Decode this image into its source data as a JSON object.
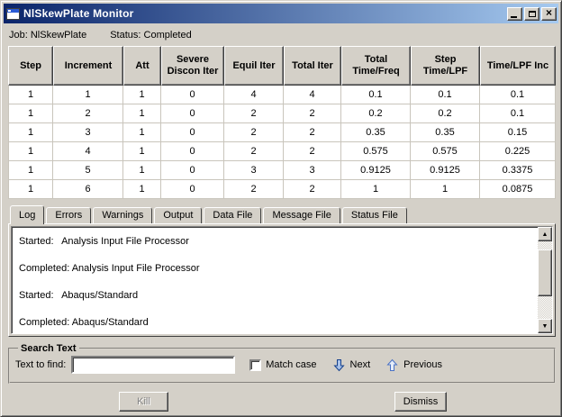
{
  "window": {
    "title": "NlSkewPlate Monitor"
  },
  "icons": {
    "close": "×",
    "scroll_up": "▲",
    "scroll_down": "▼"
  },
  "colors": {
    "chrome": "#d4d0c8",
    "titlebar_start": "#0a246a",
    "titlebar_end": "#a6caf0",
    "next_arrow_fill": "#a9c2e9",
    "next_arrow_stroke": "#16418c",
    "prev_arrow_fill": "#e6edf9",
    "prev_arrow_stroke": "#4a72c4"
  },
  "status_line": {
    "job_label": "Job:",
    "job_value": "NlSkewPlate",
    "status_label": "Status:",
    "status_value": "Completed"
  },
  "table": {
    "headers": [
      "Step",
      "Increment",
      "Att",
      "Severe Discon Iter",
      "Equil Iter",
      "Total Iter",
      "Total Time/Freq",
      "Step Time/LPF",
      "Time/LPF Inc"
    ],
    "rows": [
      [
        "1",
        "1",
        "1",
        "0",
        "4",
        "4",
        "0.1",
        "0.1",
        "0.1"
      ],
      [
        "1",
        "2",
        "1",
        "0",
        "2",
        "2",
        "0.2",
        "0.2",
        "0.1"
      ],
      [
        "1",
        "3",
        "1",
        "0",
        "2",
        "2",
        "0.35",
        "0.35",
        "0.15"
      ],
      [
        "1",
        "4",
        "1",
        "0",
        "2",
        "2",
        "0.575",
        "0.575",
        "0.225"
      ],
      [
        "1",
        "5",
        "1",
        "0",
        "3",
        "3",
        "0.9125",
        "0.9125",
        "0.3375"
      ],
      [
        "1",
        "6",
        "1",
        "0",
        "2",
        "2",
        "1",
        "1",
        "0.0875"
      ]
    ]
  },
  "tabs": {
    "items": [
      "Log",
      "Errors",
      "Warnings",
      "Output",
      "Data File",
      "Message File",
      "Status File"
    ],
    "active_index": 0
  },
  "log": {
    "lines": [
      "Started:   Analysis Input File Processor",
      "Completed: Analysis Input File Processor",
      "Started:   Abaqus/Standard",
      "Completed: Abaqus/Standard"
    ]
  },
  "search": {
    "group_title": "Search Text",
    "find_label": "Text to find:",
    "input_value": "",
    "match_case_label": "Match case",
    "match_case_checked": false,
    "next_label": "Next",
    "previous_label": "Previous"
  },
  "actions": {
    "kill_label": "Kill",
    "kill_enabled": false,
    "dismiss_label": "Dismiss"
  }
}
